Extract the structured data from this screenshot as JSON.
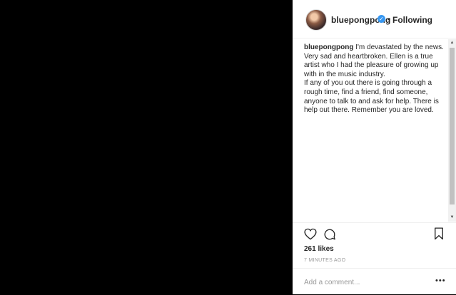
{
  "post": {
    "username": "bluepongpong",
    "follow_status": "Following",
    "separator": "•",
    "verified_badge": "✓",
    "caption_user": "bluepongpong",
    "caption_line1": " I'm devastated by the news. Very sad and heartbroken. Ellen is a true artist who I had the pleasure of growing up with in the music industry.",
    "caption_line2": "If any of you out there is going through a rough time, find a friend, find someone, anyone to talk to and ask for help. There is help out there. Remember you are loved.",
    "likes": "261 likes",
    "timestamp": "7 MINUTES AGO",
    "comment_placeholder": "Add a comment...",
    "more_label": "•••"
  },
  "icons": {
    "heart": "heart-icon",
    "comment": "comment-icon",
    "bookmark": "bookmark-icon",
    "verified": "verified-icon"
  },
  "colors": {
    "verified": "#3897f0",
    "text": "#262626",
    "muted": "#999999"
  }
}
